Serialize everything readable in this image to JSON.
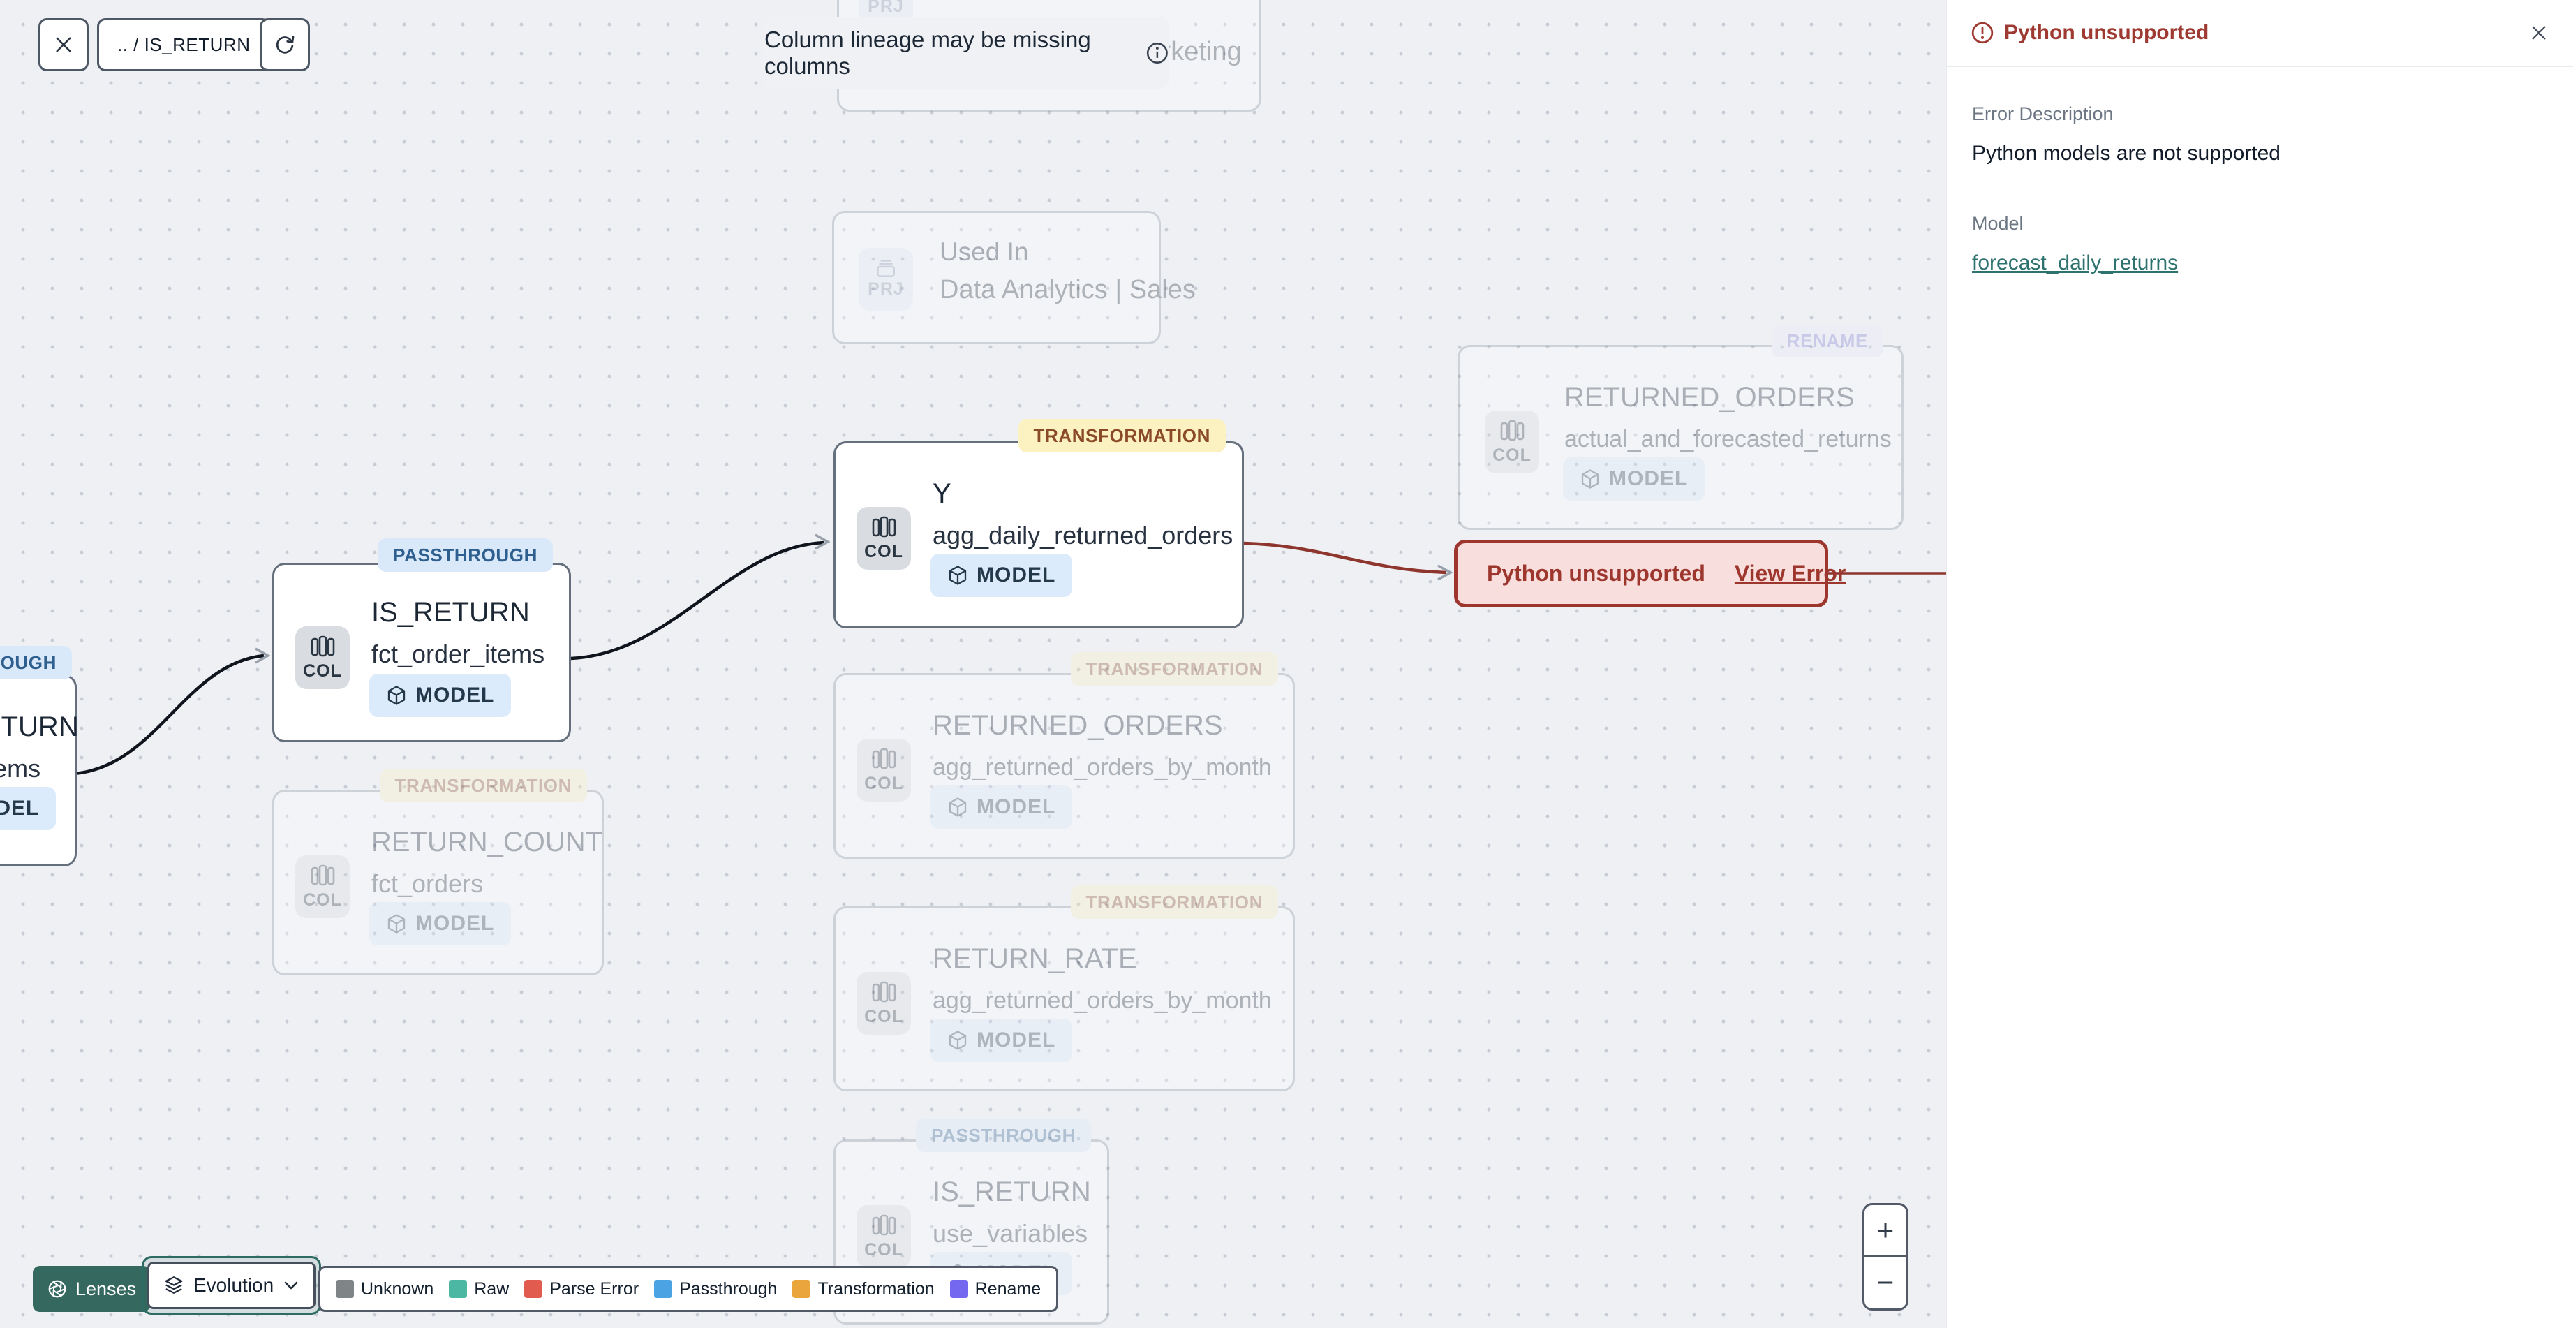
{
  "toolbar": {
    "breadcrumb": ".. / IS_RETURN"
  },
  "banner": {
    "text": "Column lineage may be missing columns"
  },
  "side_panel": {
    "title": "Python unsupported",
    "error_description_label": "Error Description",
    "error_description": "Python models are not supported",
    "model_label": "Model",
    "model_link": "forecast_daily_returns"
  },
  "error_node": {
    "label": "Python unsupported",
    "action": "View Error"
  },
  "badges": {
    "transformation": "TRANSFORMATION",
    "passthrough": "PASSTHROUGH",
    "rename": "RENAME"
  },
  "node_chip": {
    "column": "COL",
    "project": "PRJ"
  },
  "model_badge_label": "MODEL",
  "nodes": {
    "marketing": {
      "subtitle": "Data Analytics | Marketing"
    },
    "used_in": {
      "title": "Used In",
      "subtitle": "Data Analytics | Sales"
    },
    "returned_orders_rename": {
      "title": "RETURNED_ORDERS",
      "subtitle": "actual_and_forecasted_returns"
    },
    "y": {
      "title": "Y",
      "subtitle": "agg_daily_returned_orders"
    },
    "is_return": {
      "title": "IS_RETURN",
      "subtitle": "fct_order_items"
    },
    "is_return_offscreen": {
      "title": "IS_RETURN",
      "subtitle": "fct_order_items"
    },
    "returned_orders_month": {
      "title": "RETURNED_ORDERS",
      "subtitle": "agg_returned_orders_by_month"
    },
    "return_count": {
      "title": "RETURN_COUNT",
      "subtitle": "fct_orders"
    },
    "return_rate": {
      "title": "RETURN_RATE",
      "subtitle": "agg_returned_orders_by_month"
    },
    "use_variables": {
      "title": "IS_RETURN",
      "subtitle": "use_variables"
    }
  },
  "legend": {
    "items": [
      {
        "label": "Unknown",
        "color": "#7f8487"
      },
      {
        "label": "Raw",
        "color": "#4cb8a4"
      },
      {
        "label": "Parse Error",
        "color": "#e15b4f"
      },
      {
        "label": "Passthrough",
        "color": "#4ba3e3"
      },
      {
        "label": "Transformation",
        "color": "#eaa63c"
      },
      {
        "label": "Rename",
        "color": "#7468f0"
      }
    ]
  },
  "lens_bar": {
    "lenses_label": "Lenses",
    "active_lens": "Evolution"
  },
  "zoom_controls": {
    "zoom_in": "+",
    "zoom_out": "−"
  },
  "colors": {
    "error_red": "#9e3a31",
    "link_teal": "#2e7270",
    "edge_black": "#10151d",
    "edge_red": "#8e362d"
  }
}
